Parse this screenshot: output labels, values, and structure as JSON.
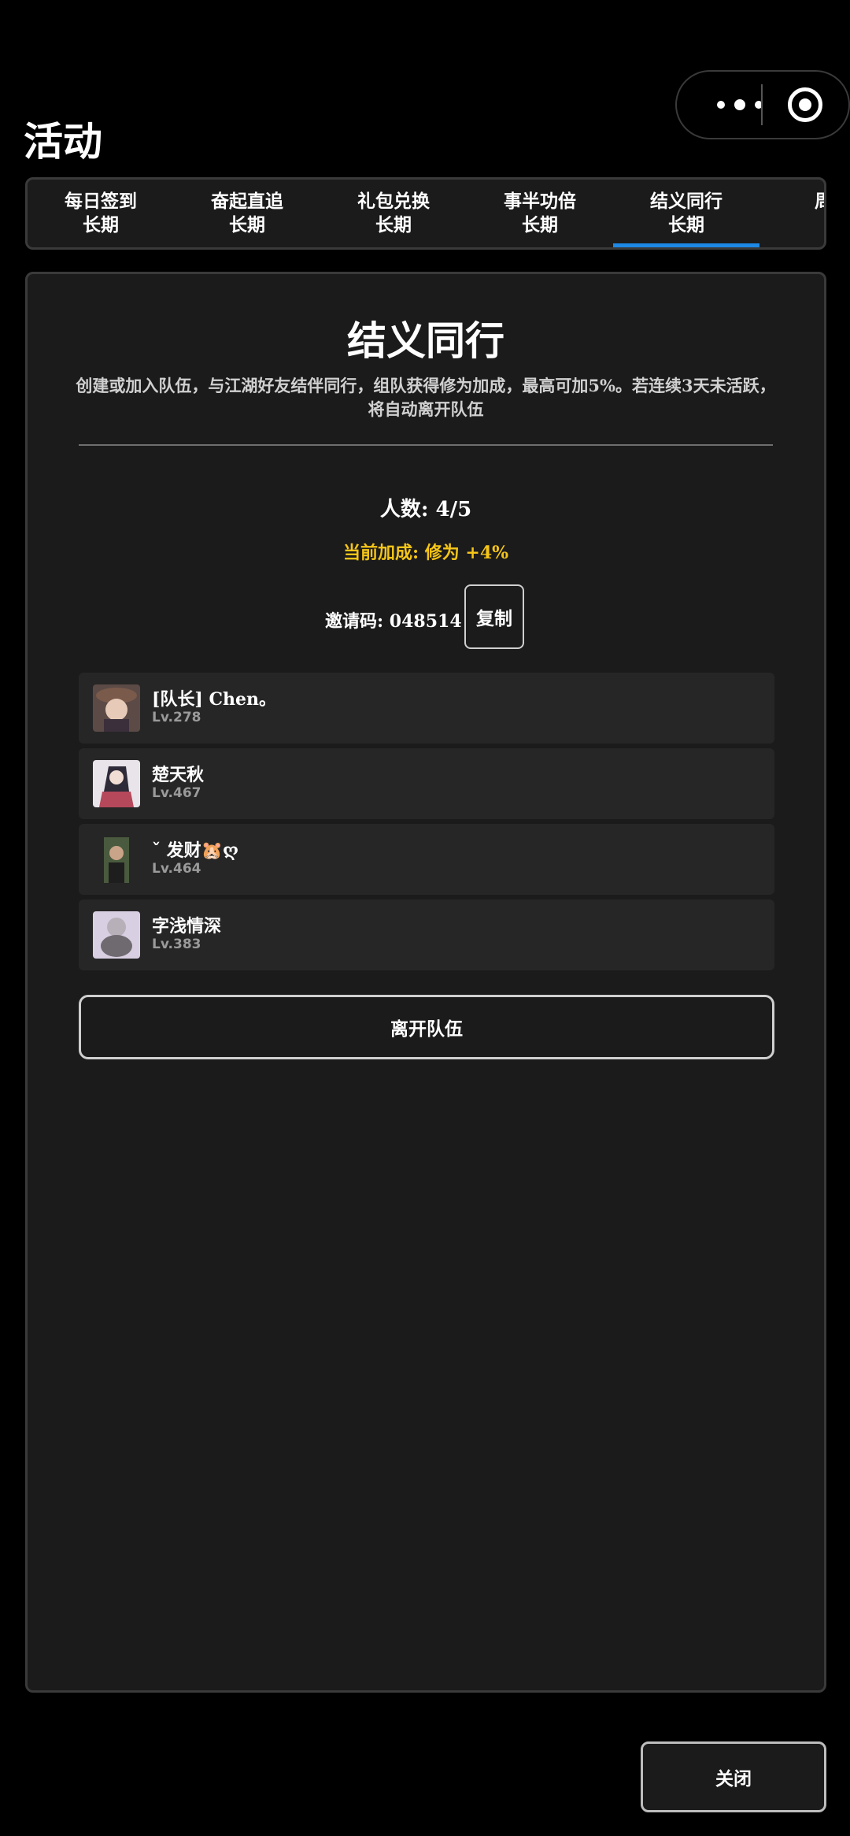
{
  "header": {
    "title": "活动"
  },
  "tabs": [
    {
      "label": "每日签到",
      "sub": "长期",
      "active": false
    },
    {
      "label": "奋起直追",
      "sub": "长期",
      "active": false
    },
    {
      "label": "礼包兑换",
      "sub": "长期",
      "active": false
    },
    {
      "label": "事半功倍",
      "sub": "长期",
      "active": false
    },
    {
      "label": "结义同行",
      "sub": "长期",
      "active": true
    },
    {
      "label": "周常",
      "sub": "长",
      "active": false
    }
  ],
  "panel": {
    "title": "结义同行",
    "description": "创建或加入队伍，与江湖好友结伴同行，组队获得修为加成，最高可加5%。若连续3天未活跃，将自动离开队伍",
    "count": "人数: 4/5",
    "bonus": "当前加成: 修为 +4%",
    "invite": "邀请码: 048514",
    "copy_label": "复制",
    "members": [
      {
        "name": "[队长] Chen。",
        "level": "Lv.278"
      },
      {
        "name": "楚天秋",
        "level": "Lv.467"
      },
      {
        "name": "ˇ 发财🐹ღ",
        "level": "Lv.464"
      },
      {
        "name": "字浅情深",
        "level": "Lv.383"
      }
    ],
    "leave_label": "离开队伍"
  },
  "footer": {
    "close_label": "关闭"
  },
  "colors": {
    "accent": "#1e88e5",
    "bonus": "#f5c518",
    "panel_bg": "#1b1b1b"
  }
}
